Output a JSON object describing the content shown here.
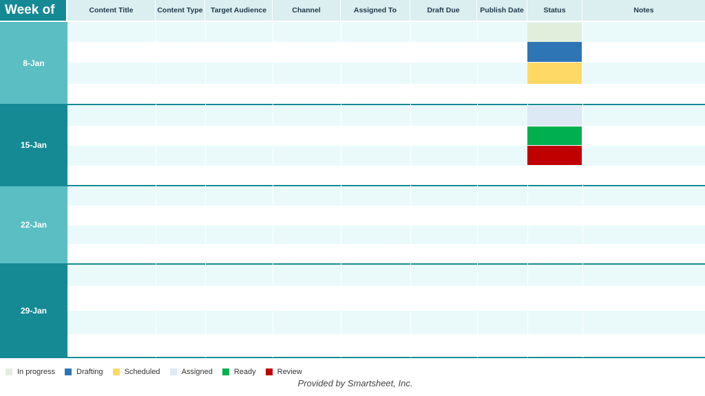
{
  "header": {
    "week_of": "Week of",
    "columns": [
      "Content Title",
      "Content Type",
      "Target Audience",
      "Channel",
      "Assigned To",
      "Draft Due",
      "Publish Date",
      "Status",
      "Notes"
    ]
  },
  "weeks": [
    {
      "label": "8-Jan",
      "color": "#5bbec3",
      "statuses": [
        "#e2eedc",
        "#2e75b6",
        "#ffd966"
      ]
    },
    {
      "label": "15-Jan",
      "color": "#158a95",
      "statuses": [
        "#dde9f5",
        "#00b050",
        "#c00000"
      ]
    },
    {
      "label": "22-Jan",
      "color": "#5bbec3",
      "statuses": []
    },
    {
      "label": "29-Jan",
      "color": "#158a95",
      "statuses": []
    }
  ],
  "legend": [
    {
      "label": "In progress",
      "color": "#e2eedc"
    },
    {
      "label": "Drafting",
      "color": "#2e75b6"
    },
    {
      "label": "Scheduled",
      "color": "#ffd966"
    },
    {
      "label": "Assigned",
      "color": "#dde9f5"
    },
    {
      "label": "Ready",
      "color": "#00b050"
    },
    {
      "label": "Review",
      "color": "#c00000"
    }
  ],
  "footer": {
    "credit": "Provided by Smartsheet, Inc."
  }
}
